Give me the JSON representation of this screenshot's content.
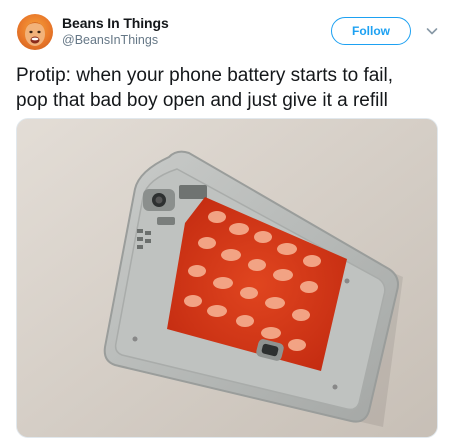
{
  "tweet": {
    "author": {
      "name": "Beans In Things",
      "handle": "@BeansInThings"
    },
    "follow_label": "Follow",
    "text_lines": [
      "Protip: when your phone battery starts to fail,",
      "pop that bad boy open and just give it a refill"
    ],
    "colors": {
      "accent": "#1da1f2",
      "secondary_text": "#657786",
      "primary_text": "#14171a"
    },
    "icons": {
      "menu": "chevron-down-icon"
    }
  }
}
